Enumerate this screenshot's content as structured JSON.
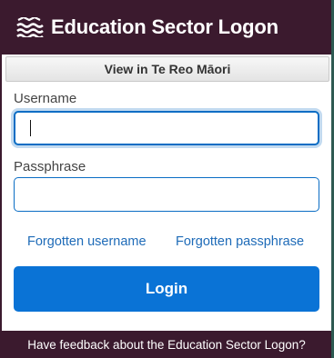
{
  "header": {
    "title": "Education Sector Logon",
    "logo_icon": "waves-logo-icon"
  },
  "language_toggle": {
    "label": "View in Te Reo Māori"
  },
  "form": {
    "username_label": "Username",
    "username_value": "",
    "passphrase_label": "Passphrase",
    "passphrase_value": ""
  },
  "links": {
    "forgotten_username": "Forgotten username",
    "forgotten_passphrase": "Forgotten passphrase"
  },
  "login_button": {
    "label": "Login"
  },
  "footer": {
    "feedback_text": "Have feedback about the Education Sector Logon?"
  },
  "colors": {
    "brand_dark": "#3b1a2e",
    "primary_blue": "#0a73d6",
    "link_blue": "#1e6bb8",
    "side_background": "#2e5a52"
  }
}
